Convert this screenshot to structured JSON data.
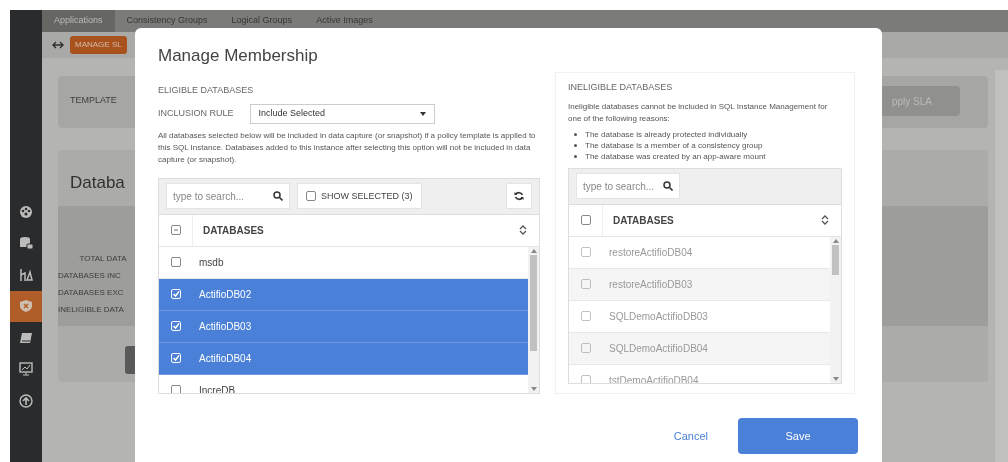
{
  "background": {
    "tabs": [
      {
        "label": "Applications",
        "selected": true
      },
      {
        "label": "Consistency Groups",
        "selected": false
      },
      {
        "label": "Logical Groups",
        "selected": false
      },
      {
        "label": "Active Images",
        "selected": false
      }
    ],
    "manage_sla_button": "MANAGE SL",
    "template_label": "TEMPLATE",
    "apply_button": "pply SLA",
    "panel_title": "Databa",
    "summary_rows": [
      "TOTAL DATA",
      "DATABASES INC",
      "DATABASES EXC",
      "INELIGIBLE DATA"
    ],
    "sidebar": [
      {
        "selected": false
      },
      {
        "selected": false
      },
      {
        "selected": false
      },
      {
        "selected": true
      },
      {
        "selected": false
      },
      {
        "selected": false
      },
      {
        "selected": false
      }
    ]
  },
  "dialog": {
    "title": "Manage Membership",
    "eligible": {
      "heading": "ELIGIBLE DATABASES",
      "rule_label": "INCLUSION RULE",
      "rule_value": "Include Selected",
      "note": "All databases selected below will be included in data capture (or snapshot) if a policy template is applied to this SQL Instance. Databases added to this instance after selecting this option will not be included in data capture (or snapshot).",
      "search": {
        "placeholder": "type to search..."
      },
      "show_selected": {
        "label": "SHOW SELECTED (3)",
        "checked": false
      },
      "select_all": {
        "checked": false,
        "indeterminate": true
      },
      "column": "DATABASES",
      "rows": [
        {
          "name": "msdb",
          "checked": false,
          "selected": false
        },
        {
          "name": "ActifioDB02",
          "checked": true,
          "selected": true
        },
        {
          "name": "ActifioDB03",
          "checked": true,
          "selected": true
        },
        {
          "name": "ActifioDB04",
          "checked": true,
          "selected": true
        },
        {
          "name": "IncreDB",
          "checked": false,
          "selected": false
        }
      ]
    },
    "ineligible": {
      "heading": "INELIGIBLE DATABASES",
      "note": "Ineligible databases cannot be included in SQL Instance Management for one of the following reasons:",
      "reasons": [
        "The database is already protected individually",
        "The database is a member of a consistency group",
        "The database was created by an app-aware mount"
      ],
      "search": {
        "placeholder": "type to search..."
      },
      "select_all": {
        "checked": false,
        "indeterminate": false
      },
      "column": "DATABASES",
      "rows": [
        {
          "name": "restoreActifioDB04",
          "checked": false,
          "disabled": true
        },
        {
          "name": "restoreActifioDB03",
          "checked": false,
          "disabled": true
        },
        {
          "name": "SQLDemoActifioDB03",
          "checked": false,
          "disabled": true
        },
        {
          "name": "SQLDemoActifioDB04",
          "checked": false,
          "disabled": true
        },
        {
          "name": "tstDemoActifioDB04",
          "checked": false,
          "disabled": true
        }
      ]
    },
    "cancel": "Cancel",
    "save": "Save"
  }
}
